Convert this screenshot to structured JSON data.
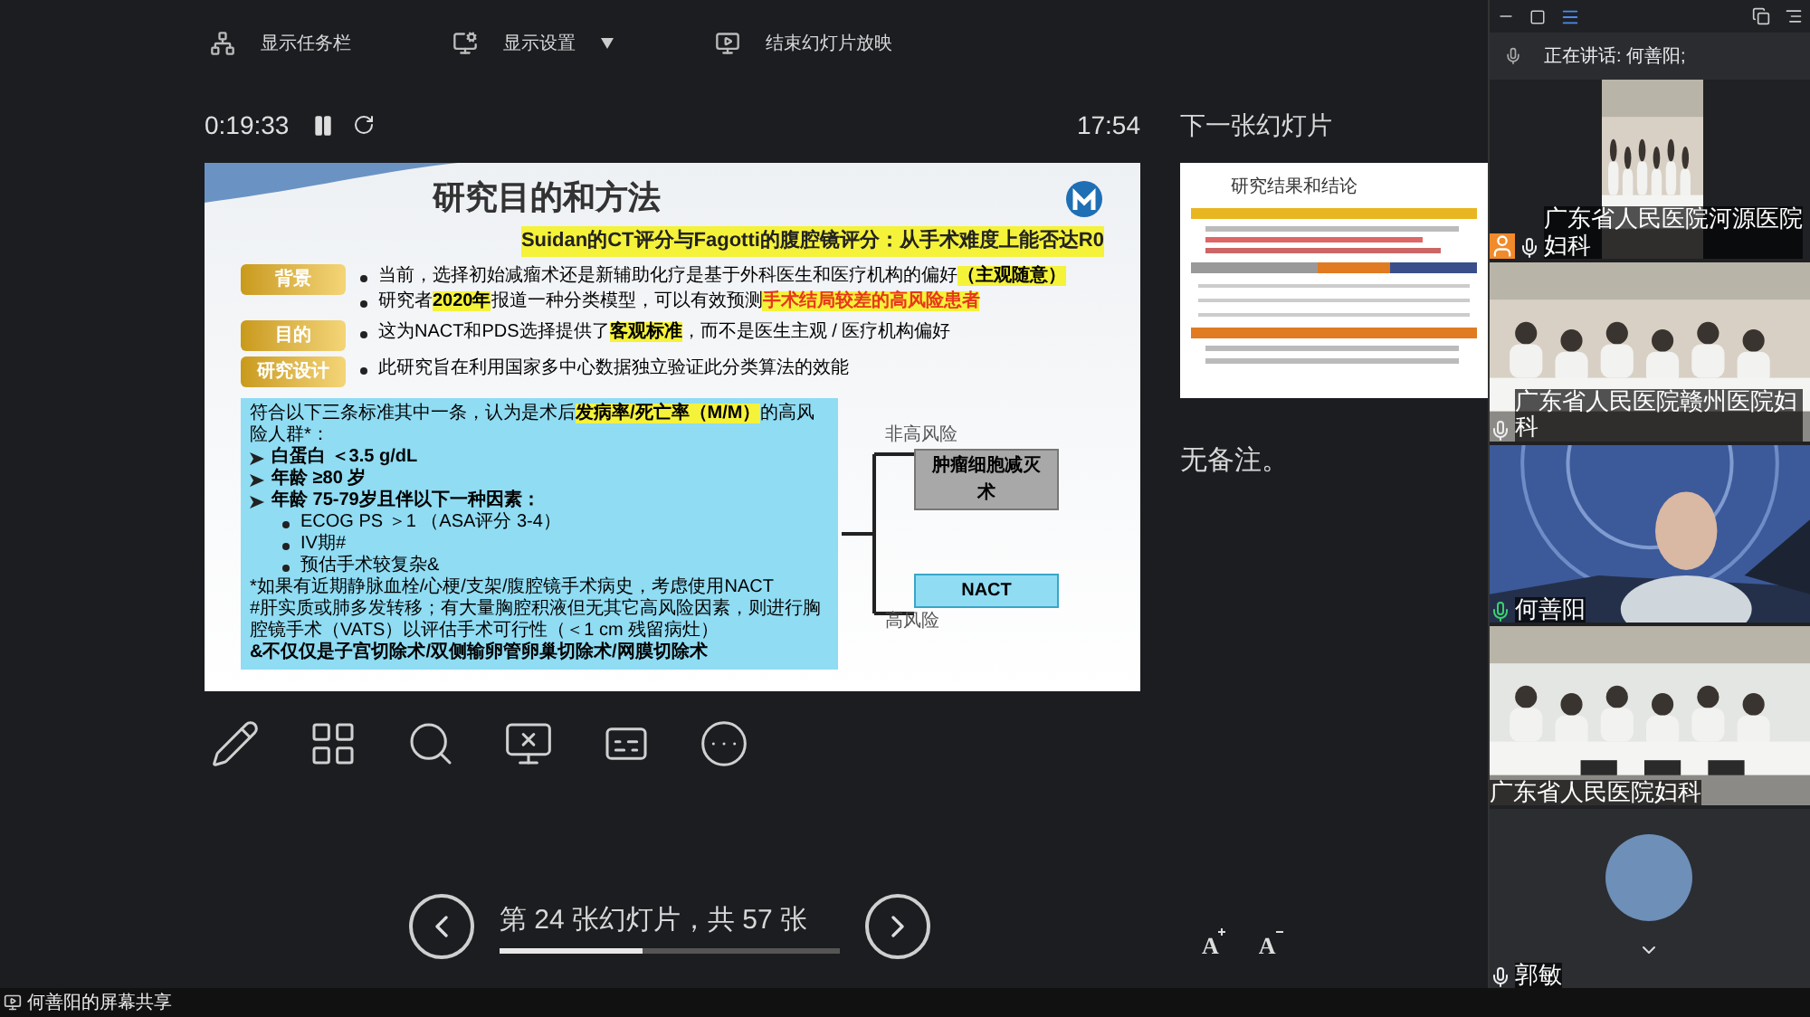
{
  "toolbar": [
    {
      "label": "显示任务栏",
      "dropdown": false
    },
    {
      "label": "显示设置",
      "dropdown": true
    },
    {
      "label": "结束幻灯片放映",
      "dropdown": false
    }
  ],
  "timer": {
    "elapsed": "0:19:33",
    "clock": "17:54"
  },
  "slide": {
    "title": "研究目的和方法",
    "subtitle": "Suidan的CT评分与Fagotti的腹腔镜评分：从手术难度上能否达R0",
    "sections": [
      {
        "label": "背景",
        "bullets": [
          [
            {
              "text": "当前，选择初始减瘤术还是新辅助化疗是基于外科医生和医疗机构的偏好",
              "kind": "plain"
            },
            {
              "text": "（主观随意）",
              "kind": "highlight"
            }
          ],
          [
            {
              "text": "研究者",
              "kind": "plain"
            },
            {
              "text": "2020年",
              "kind": "highlight"
            },
            {
              "text": "报道一种分类模型，可以有效预测",
              "kind": "plain"
            },
            {
              "text": "手术结局较差的高风险患者",
              "kind": "alert"
            }
          ]
        ]
      },
      {
        "label": "目的",
        "bullets": [
          [
            {
              "text": "这为NACT和PDS选择提供了",
              "kind": "plain"
            },
            {
              "text": "客观标准",
              "kind": "highlight"
            },
            {
              "text": "，而不是医生主观 / 医疗机构偏好",
              "kind": "plain"
            }
          ]
        ]
      },
      {
        "label": "研究设计",
        "bullets": [
          [
            {
              "text": "此研究旨在利用国家多中心数据独立验证此分类算法的效能",
              "kind": "plain"
            }
          ]
        ]
      }
    ],
    "criteria": {
      "intro": [
        {
          "text": "符合以下三条标准其中一条，认为是术后",
          "kind": "plain"
        },
        {
          "text": "发病率/死亡率（M/M）",
          "kind": "highlight"
        },
        {
          "text": "的高风险人群*：",
          "kind": "plain"
        }
      ],
      "items": [
        {
          "text": "白蛋白 ＜3.5 g/dL"
        },
        {
          "text": "年龄 ≥80 岁"
        },
        {
          "text": "年龄 75-79岁且伴以下一种因素：",
          "children": [
            {
              "text": "ECOG PS ＞1 （ASA评分 3-4）"
            },
            {
              "text": "IV期#"
            },
            {
              "text": "预估手术较复杂&"
            }
          ]
        }
      ],
      "footnotes": [
        {
          "text": "*如果有近期静脉血栓/心梗/支架/腹腔镜手术病史，考虑使用NACT",
          "bold": false
        },
        {
          "text": "#肝实质或肺多发转移；有大量胸腔积液但无其它高风险因素，则进行胸腔镜手术（VATS）以评估手术可行性（＜1 cm 残留病灶）",
          "bold": false
        },
        {
          "text": "&不仅仅是子宫切除术/双侧输卵管卵巢切除术/网膜切除术",
          "bold": true
        }
      ]
    },
    "flow": [
      {
        "label": "非高风险",
        "outcome": "肿瘤细胞减灭术",
        "kind": "surgery"
      },
      {
        "label": "高风险",
        "outcome": "NACT",
        "kind": "chemo"
      }
    ]
  },
  "next_slide": {
    "heading": "下一张幻灯片",
    "thumbnail_title": "研究结果和结论",
    "notes": "无备注。"
  },
  "navigation": {
    "counter": "第 24 张幻灯片，共 57 张",
    "level": 0.42
  },
  "font_buttons": [
    {
      "label": "A",
      "kind": "increase"
    },
    {
      "label": "A",
      "kind": "decrease"
    }
  ],
  "meeting": {
    "speaking": "正在讲话: 何善阳;",
    "tiles": [
      {
        "name": "广东省人民医院河源医院妇科",
        "kind": "portrait",
        "host": true,
        "mic": true,
        "speaking": false
      },
      {
        "name": "广东省人民医院赣州医院妇科",
        "kind": "room",
        "host": false,
        "mic": true,
        "speaking": false
      },
      {
        "name": "何善阳",
        "kind": "person",
        "host": false,
        "mic": true,
        "speaking": true
      },
      {
        "name": "广东省人民医院妇科",
        "kind": "hall",
        "host": false,
        "mic": false
      },
      {
        "name": "郭敏",
        "kind": "avatar",
        "host": false,
        "mic": true,
        "speaking": false
      }
    ]
  },
  "status": "何善阳的屏幕共享"
}
